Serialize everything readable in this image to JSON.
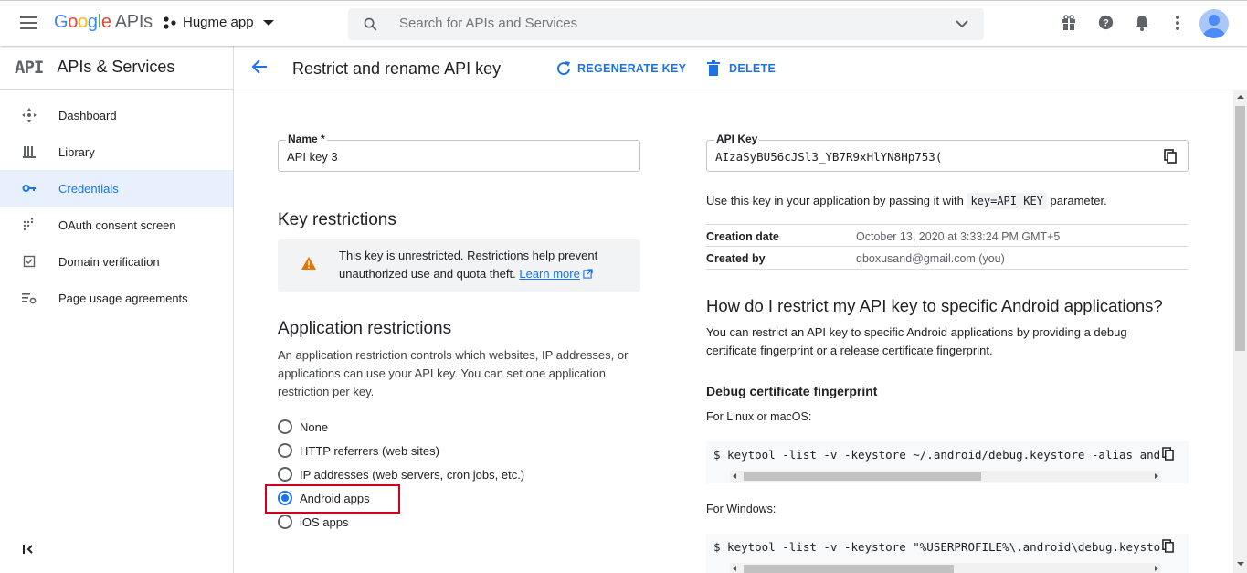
{
  "topbar": {
    "logo_google": "Google",
    "logo_apis": "APIs",
    "project_name": "Hugme app",
    "search_placeholder": "Search for APIs and Services"
  },
  "sidebar": {
    "logo": "API",
    "title": "APIs & Services",
    "items": [
      {
        "label": "Dashboard",
        "icon": "dashboard-icon"
      },
      {
        "label": "Library",
        "icon": "library-icon"
      },
      {
        "label": "Credentials",
        "icon": "key-icon",
        "active": true
      },
      {
        "label": "OAuth consent screen",
        "icon": "oauth-icon"
      },
      {
        "label": "Domain verification",
        "icon": "checkbox-icon"
      },
      {
        "label": "Page usage agreements",
        "icon": "settings-list-icon"
      }
    ]
  },
  "header": {
    "title": "Restrict and rename API key",
    "regenerate_label": "REGENERATE KEY",
    "delete_label": "DELETE"
  },
  "form": {
    "name_label": "Name *",
    "name_value": "API key 3",
    "key_restrictions_title": "Key restrictions",
    "warning_text": "This key is unrestricted. Restrictions help prevent unauthorized use and quota theft.",
    "learn_more": "Learn more",
    "app_restrictions_title": "Application restrictions",
    "app_restrictions_desc": "An application restriction controls which websites, IP addresses, or applications can use your API key. You can set one application restriction per key.",
    "radio_options": [
      {
        "label": "None",
        "selected": false
      },
      {
        "label": "HTTP referrers (web sites)",
        "selected": false
      },
      {
        "label": "IP addresses (web servers, cron jobs, etc.)",
        "selected": false
      },
      {
        "label": "Android apps",
        "selected": true
      },
      {
        "label": "iOS apps",
        "selected": false
      }
    ]
  },
  "keyinfo": {
    "api_key_label": "API Key",
    "api_key_value": "AIzaSyBU56cJSl3_YB7R9xHlYN8Hp753(",
    "usage_prefix": "Use this key in your application by passing it with",
    "usage_code": "key=API_KEY",
    "usage_suffix": "parameter.",
    "creation_date_label": "Creation date",
    "creation_date_value": "October 13, 2020 at 3:33:24 PM GMT+5",
    "created_by_label": "Created by",
    "created_by_value": "qboxusand@gmail.com (you)"
  },
  "help": {
    "title": "How do I restrict my API key to specific Android applications?",
    "desc": "You can restrict an API key to specific Android applications by providing a debug certificate fingerprint or a release certificate fingerprint.",
    "debug_title": "Debug certificate fingerprint",
    "linux_label": "For Linux or macOS:",
    "linux_cmd": "$ keytool -list -v -keystore ~/.android/debug.keystore -alias androi",
    "windows_label": "For Windows:",
    "windows_cmd": "$ keytool -list -v -keystore \"%USERPROFILE%\\.android\\debug.keystore\""
  },
  "colors": {
    "accent": "#1a73e8",
    "highlight": "#d0021b",
    "warning": "#e37400"
  }
}
